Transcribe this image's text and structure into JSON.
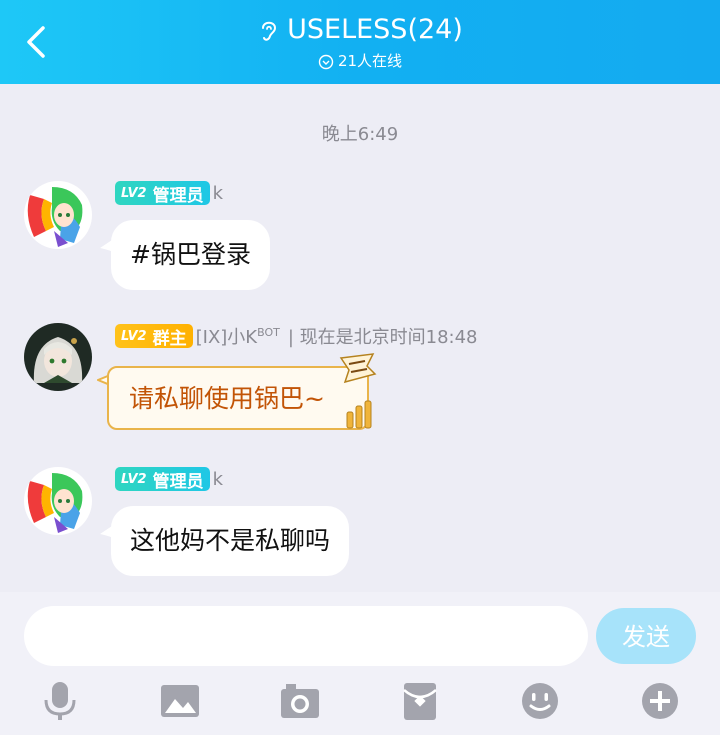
{
  "header": {
    "title": "USELESS(24)",
    "online_text": "21人在线",
    "back_icon": "chevron-left-icon",
    "mode_icon": "ear-icon",
    "background_color": "#14aaf0"
  },
  "chat": {
    "time_divider": "晚上6:49",
    "messages": [
      {
        "badge_level": "LV2",
        "badge_role": "管理员",
        "badge_color": "#1fc7e6",
        "nickname": "k",
        "text": "#锅巴登录"
      },
      {
        "badge_level": "LV2",
        "badge_role": "群主",
        "badge_color": "#ffb100",
        "nickname": "[IX]小K",
        "nickname_sup": "BOT",
        "status": "| 现在是北京时间18:48",
        "text": "请私聊使用锅巴~"
      },
      {
        "badge_level": "LV2",
        "badge_role": "管理员",
        "badge_color": "#1fc7e6",
        "nickname": "k",
        "text": "这他妈不是私聊吗"
      }
    ]
  },
  "input": {
    "placeholder": "",
    "send_label": "发送",
    "send_color": "#a7e3fa"
  },
  "toolbar": {
    "icons": [
      "microphone-icon",
      "image-icon",
      "camera-icon",
      "red-packet-icon",
      "emoji-icon",
      "plus-icon"
    ]
  }
}
